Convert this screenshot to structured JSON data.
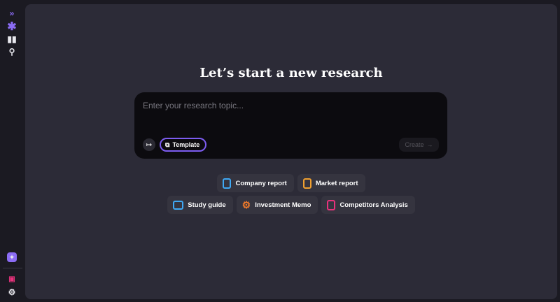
{
  "sidebar": {
    "top": [
      "expand-icon",
      "asterisk-icon",
      "library-icon",
      "search-icon"
    ],
    "bottom": [
      "sparkle-icon",
      "presentation-icon",
      "user-settings-icon"
    ]
  },
  "main": {
    "title": "Let’s start a new research",
    "input_placeholder": "Enter your research topic...",
    "template_label": "Template",
    "create_label": "Create",
    "suggestions_row1": [
      {
        "label": "Company report",
        "color": "#3fa9f5"
      },
      {
        "label": "Market report",
        "color": "#f0a030"
      }
    ],
    "suggestions_row2": [
      {
        "label": "Study guide",
        "color": "#3fa9f5"
      },
      {
        "label": "Investment Memo",
        "color": "#f07a2a"
      },
      {
        "label": "Competitors Analysis",
        "color": "#e8327c"
      }
    ]
  },
  "colors": {
    "accent": "#7c5cf0"
  }
}
